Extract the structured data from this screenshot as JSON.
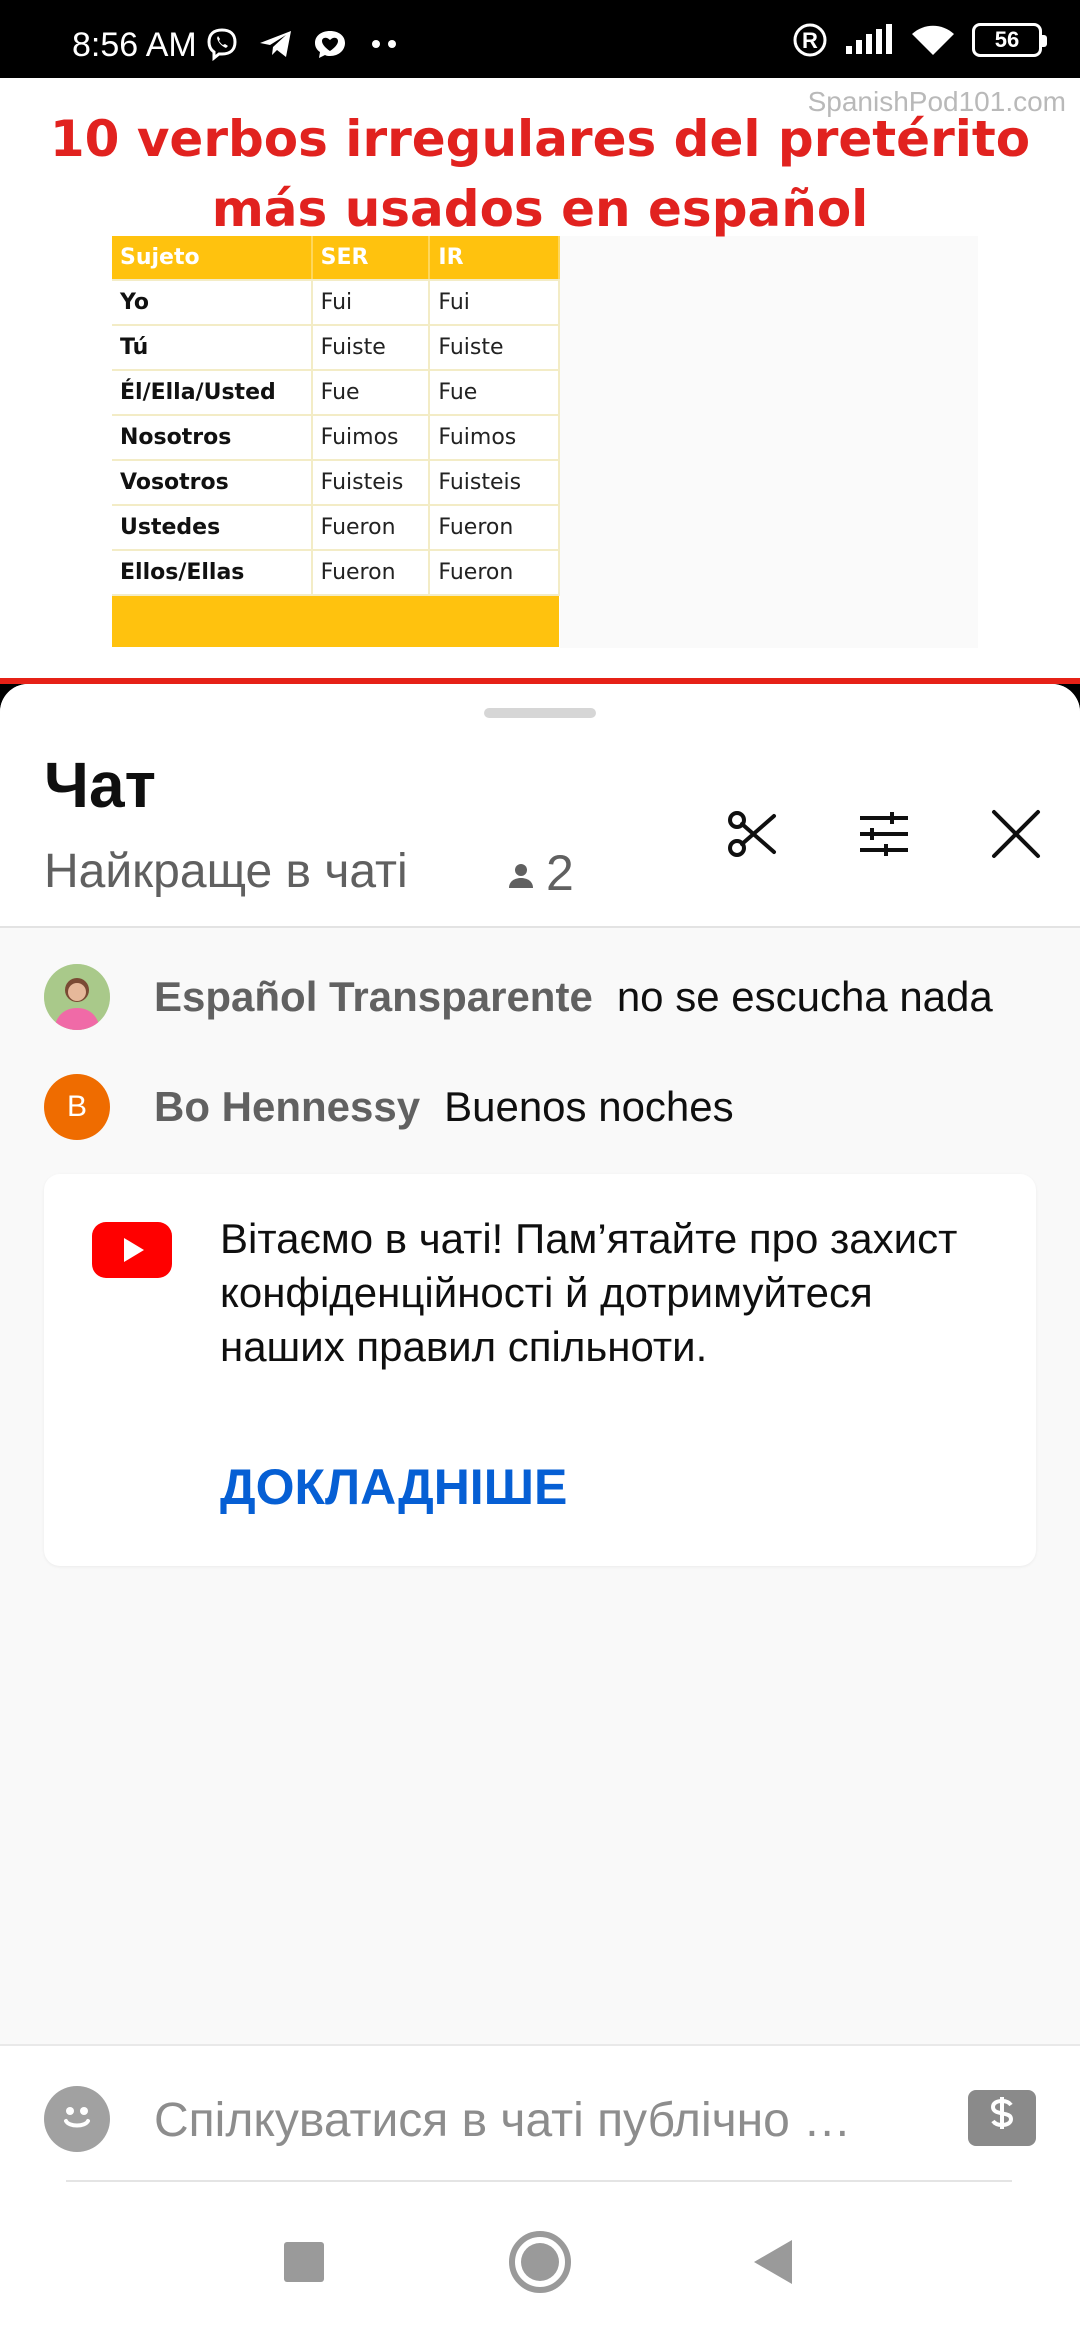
{
  "status_bar": {
    "time": "8:56 AM",
    "battery": "56",
    "icons": [
      "viber-icon",
      "telegram-icon",
      "heart-chat-icon",
      "more-dots-icon",
      "registered-icon",
      "signal-icon",
      "wifi-icon",
      "battery-icon"
    ]
  },
  "video": {
    "watermark": "SpanishPod101.com",
    "title_line1": "10 verbos irregulares del pretérito",
    "title_line2": "más usados en español",
    "table": {
      "headers": [
        "Sujeto",
        "SER",
        "IR"
      ],
      "rows": [
        [
          "Yo",
          "Fui",
          "Fui"
        ],
        [
          "Tú",
          "Fuiste",
          "Fuiste"
        ],
        [
          "Él/Ella/Usted",
          "Fue",
          "Fue"
        ],
        [
          "Nosotros",
          "Fuimos",
          "Fuimos"
        ],
        [
          "Vosotros",
          "Fuisteis",
          "Fuisteis"
        ],
        [
          "Ustedes",
          "Fueron",
          "Fueron"
        ],
        [
          "Ellos/Ellas",
          "Fueron",
          "Fueron"
        ]
      ]
    },
    "colors": {
      "title": "#e1221f",
      "table_header": "#ffc20e",
      "progress": "#e62117"
    }
  },
  "chat": {
    "title": "Чат",
    "subtitle": "Найкраще в чаті",
    "viewer_count": "2",
    "actions": [
      "scissors-icon",
      "tune-icon",
      "close-icon"
    ],
    "messages": [
      {
        "author": "Español Transparente",
        "text": "no se escucha nada",
        "avatar": "photo"
      },
      {
        "author": "Bo Hennessy",
        "text": "Buenos noches",
        "avatar_letter": "B",
        "avatar_color": "#ef6c00"
      }
    ],
    "welcome": {
      "text": "Вітаємо в чаті! Пам’ятайте про захист конфіденційності й дотримуйтеся наших правил спільноти.",
      "learn_more": "ДОКЛАДНІШЕ"
    },
    "input": {
      "placeholder": "Спілкуватися в чаті публічно …"
    },
    "link_color": "#065fd4"
  },
  "nav": [
    "recents-square-icon",
    "home-circle-icon",
    "back-triangle-icon"
  ]
}
